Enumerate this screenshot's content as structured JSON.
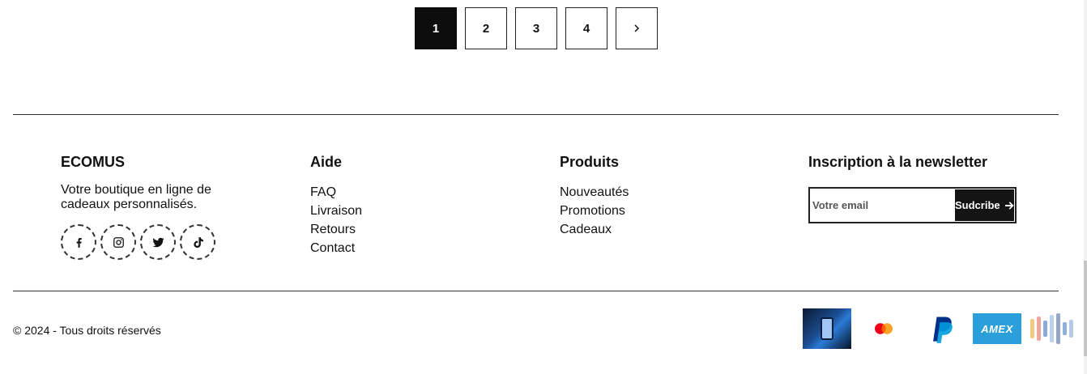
{
  "pagination": {
    "pages": [
      "1",
      "2",
      "3",
      "4"
    ],
    "active": "1",
    "next_icon": "chevron-right-icon"
  },
  "footer": {
    "brand": {
      "title": "ECOMUS",
      "description": "Votre boutique en ligne de cadeaux personnalisés.",
      "social": [
        "facebook-icon",
        "instagram-icon",
        "twitter-icon",
        "tiktok-icon"
      ]
    },
    "help": {
      "title": "Aide",
      "links": [
        "FAQ",
        "Livraison",
        "Retours",
        "Contact"
      ]
    },
    "products": {
      "title": "Produits",
      "links": [
        "Nouveautés",
        "Promotions",
        "Cadeaux"
      ]
    },
    "newsletter": {
      "title": "Inscription à la newsletter",
      "placeholder": "Votre email",
      "button_label": "Sudcribe"
    },
    "copyright": "© 2024 - Tous droits réservés",
    "payments": {
      "amex_label": "AMEX",
      "icons": [
        "payment-photo",
        "mastercard-icon",
        "paypal-icon",
        "amex-icon",
        "blurred-payment-icon"
      ]
    }
  },
  "colors": {
    "active_page_bg": "#0d0d0d",
    "button_bg": "#141414",
    "amex_blue": "#2b9fd9",
    "paypal_dark": "#003087",
    "paypal_light": "#009cde",
    "mastercard_red": "#eb001b",
    "mastercard_orange": "#f79e1b"
  }
}
